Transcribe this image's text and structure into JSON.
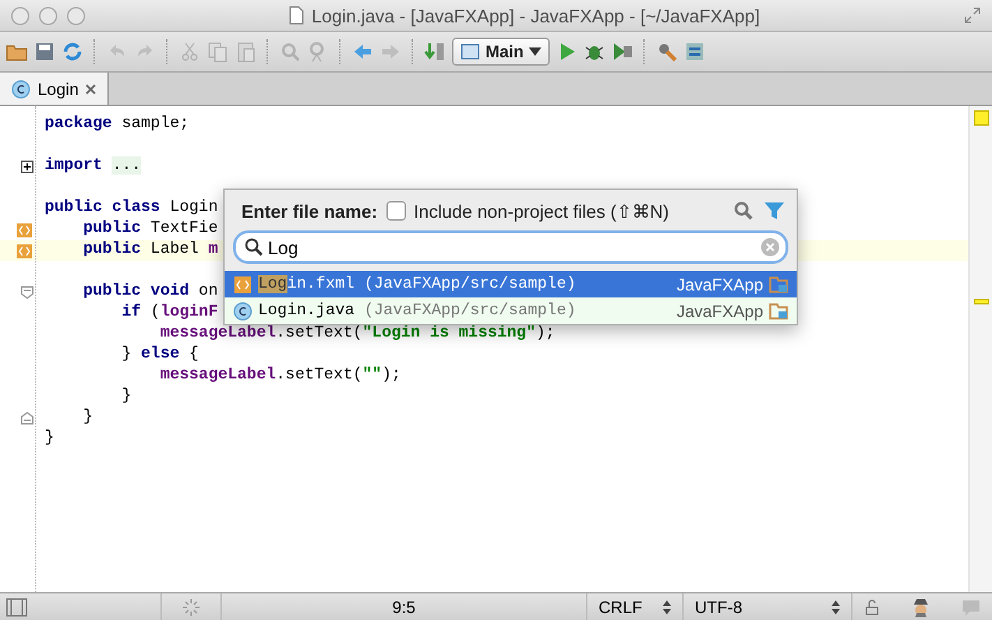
{
  "window": {
    "title": "Login.java - [JavaFXApp] - JavaFXApp - [~/JavaFXApp]"
  },
  "toolbar": [
    {
      "kind": "folder",
      "disabled": false
    },
    {
      "kind": "save",
      "disabled": false
    },
    {
      "kind": "sync",
      "disabled": false
    },
    {
      "kind": "sep"
    },
    {
      "kind": "undo",
      "disabled": true
    },
    {
      "kind": "redo",
      "disabled": true
    },
    {
      "kind": "sep"
    },
    {
      "kind": "cut",
      "disabled": true
    },
    {
      "kind": "copy",
      "disabled": true
    },
    {
      "kind": "paste",
      "disabled": true
    },
    {
      "kind": "sep"
    },
    {
      "kind": "find",
      "disabled": true
    },
    {
      "kind": "replace",
      "disabled": true
    },
    {
      "kind": "sep"
    },
    {
      "kind": "back",
      "disabled": false
    },
    {
      "kind": "forward",
      "disabled": true
    },
    {
      "kind": "sep"
    },
    {
      "kind": "build",
      "disabled": false
    },
    {
      "kind": "config",
      "label": "Main"
    },
    {
      "kind": "run",
      "disabled": false
    },
    {
      "kind": "debug",
      "disabled": false
    },
    {
      "kind": "coverage",
      "disabled": false
    },
    {
      "kind": "sep"
    },
    {
      "kind": "settings",
      "disabled": false
    },
    {
      "kind": "structure",
      "disabled": false
    }
  ],
  "tabs": [
    {
      "label": "Login",
      "selected": true
    }
  ],
  "editor": {
    "lines": [
      {
        "tokens": [
          {
            "kind": "kw",
            "text": "package"
          },
          {
            "kind": "plain",
            "text": " sample;"
          }
        ]
      },
      {
        "blank_line_before": true,
        "gutter": {
          "kind": "expand"
        },
        "tokens": [
          {
            "kind": "kw",
            "text": "import"
          },
          {
            "kind": "folded",
            "text": "..."
          }
        ]
      },
      {
        "blank_line_before": true,
        "tokens": [
          {
            "kind": "kw",
            "text": "public class"
          },
          {
            "kind": "plain",
            "text": " Login"
          }
        ]
      },
      {
        "gutter": {
          "kind": "fxml-link"
        },
        "tokens": [
          {
            "kind": "kw",
            "text": "    public"
          },
          {
            "kind": "plain",
            "text": " TextFie"
          }
        ]
      },
      {
        "gutter": {
          "kind": "fxml-link"
        },
        "current": true,
        "tokens": [
          {
            "kind": "kw",
            "text": "    public"
          },
          {
            "kind": "plain",
            "text": " Label "
          },
          {
            "kind": "field",
            "text": "m"
          }
        ]
      },
      {
        "blank_line_before": true,
        "gutter": {
          "kind": "fold-start"
        },
        "tokens": [
          {
            "kind": "kw",
            "text": "    public void"
          },
          {
            "kind": "plain",
            "text": " on"
          }
        ]
      },
      {
        "tokens": [
          {
            "kind": "kw",
            "text": "        if"
          },
          {
            "kind": "plain",
            "text": " ("
          },
          {
            "kind": "field",
            "text": "loginF"
          }
        ]
      },
      {
        "tokens": [
          {
            "kind": "field",
            "text": "            messageLabel"
          },
          {
            "kind": "plain",
            "text": ".setText("
          },
          {
            "kind": "string",
            "text": "\"Login is missing\""
          },
          {
            "kind": "plain",
            "text": ");"
          }
        ]
      },
      {
        "tokens": [
          {
            "kind": "plain",
            "text": "        } "
          },
          {
            "kind": "kw",
            "text": "else"
          },
          {
            "kind": "plain",
            "text": " {"
          }
        ]
      },
      {
        "tokens": [
          {
            "kind": "field",
            "text": "            messageLabel"
          },
          {
            "kind": "plain",
            "text": ".setText("
          },
          {
            "kind": "string",
            "text": "\"\""
          },
          {
            "kind": "plain",
            "text": ");"
          }
        ]
      },
      {
        "tokens": [
          {
            "kind": "plain",
            "text": "        }"
          }
        ]
      },
      {
        "gutter": {
          "kind": "fold-end"
        },
        "tokens": [
          {
            "kind": "plain",
            "text": "    }"
          }
        ]
      },
      {
        "tokens": [
          {
            "kind": "plain",
            "text": "}"
          }
        ]
      }
    ]
  },
  "popup": {
    "label": "Enter file name:",
    "include_checkbox": {
      "label": "Include non-project files (⇧⌘N)",
      "checked": false
    },
    "query": "Log",
    "results": [
      {
        "kind": "fxml",
        "match": "Log",
        "rest": "in.fxml",
        "path": "(JavaFXApp/src/sample)",
        "module": "JavaFXApp",
        "selected": true
      },
      {
        "kind": "class",
        "match": "Log",
        "rest": "in.java",
        "path": "(JavaFXApp/src/sample)",
        "module": "JavaFXApp",
        "selected": false
      }
    ]
  },
  "status_bar": {
    "position": "9:5",
    "line_separator": "CRLF",
    "encoding": "UTF-8"
  }
}
